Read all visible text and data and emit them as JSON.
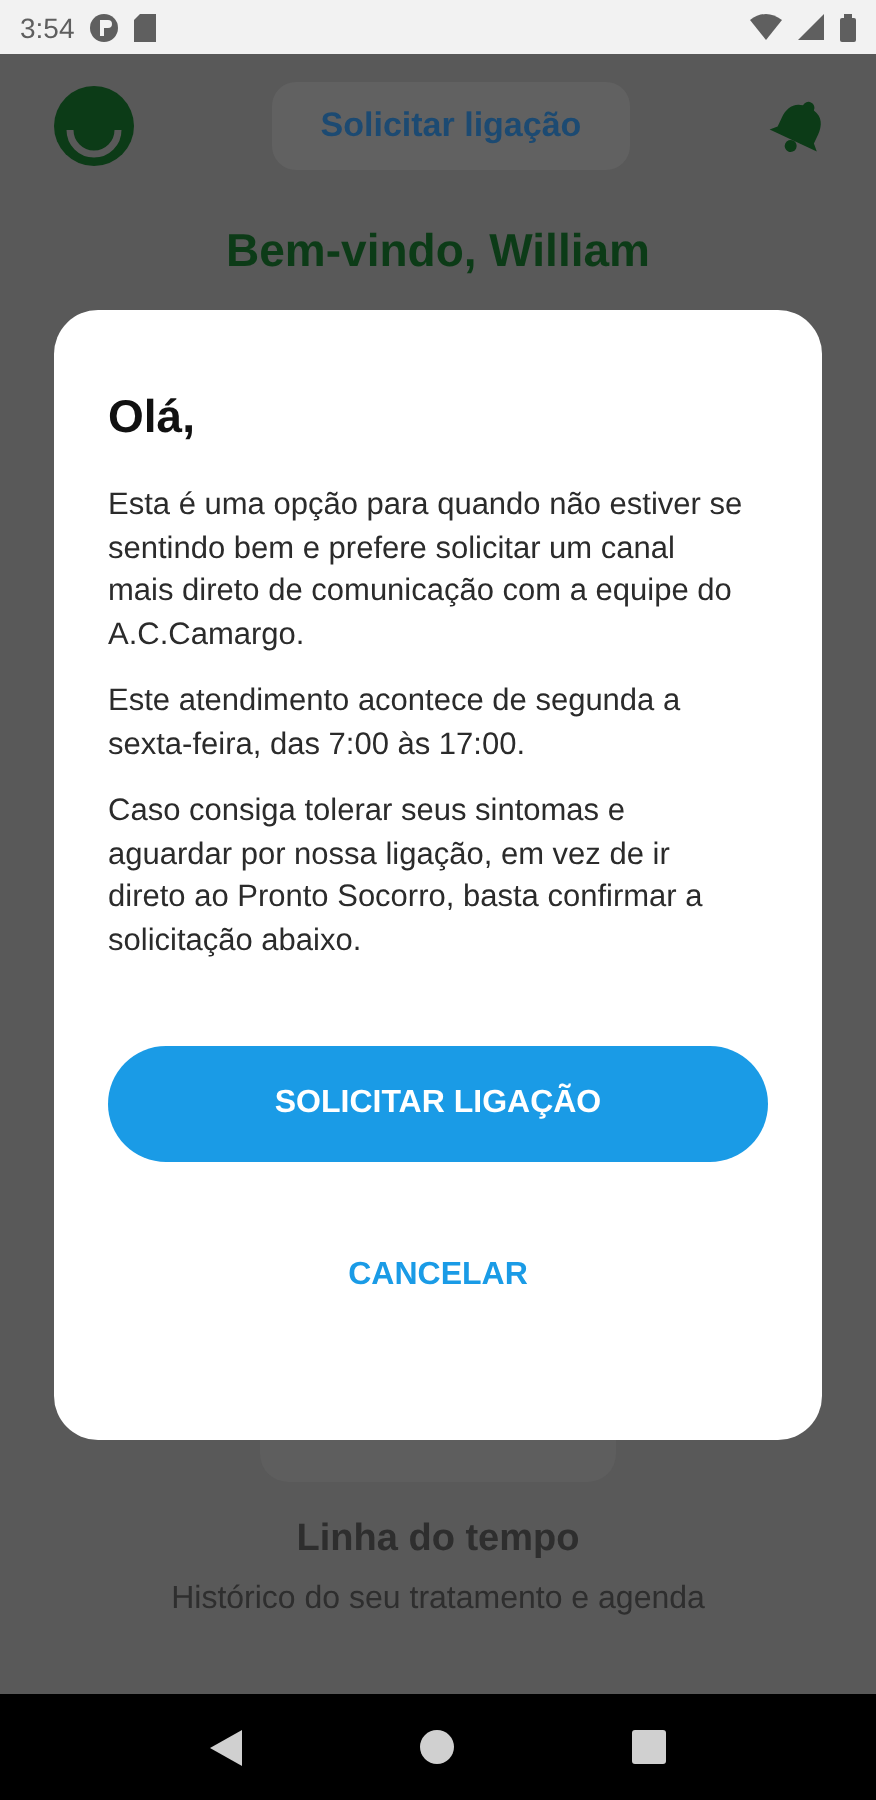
{
  "status_bar": {
    "time": "3:54"
  },
  "header": {
    "call_button": "Solicitar ligação"
  },
  "greeting": {
    "title": "Bem-vindo, William"
  },
  "timeline_card": {
    "title": "Linha do tempo",
    "description": "Histórico do seu tratamento e agenda"
  },
  "dialog": {
    "title": "Olá,",
    "paragraphs": [
      "Esta é uma opção para quando não estiver se sentindo bem e prefere solicitar um canal mais direto de comunicação com a equipe do A.C.Camargo.",
      "Este atendimento acontece de segunda a sexta-feira, das 7:00 às 17:00.",
      "Caso consiga tolerar seus sintomas e aguardar por nossa ligação, em vez de ir direto ao Pronto Socorro, basta confirmar a solicitação abaixo."
    ],
    "buttons": [
      {
        "label": "SOLICITAR LIGAÇÃO",
        "kind": "primary"
      },
      {
        "label": "CANCELAR",
        "kind": "text"
      }
    ]
  }
}
